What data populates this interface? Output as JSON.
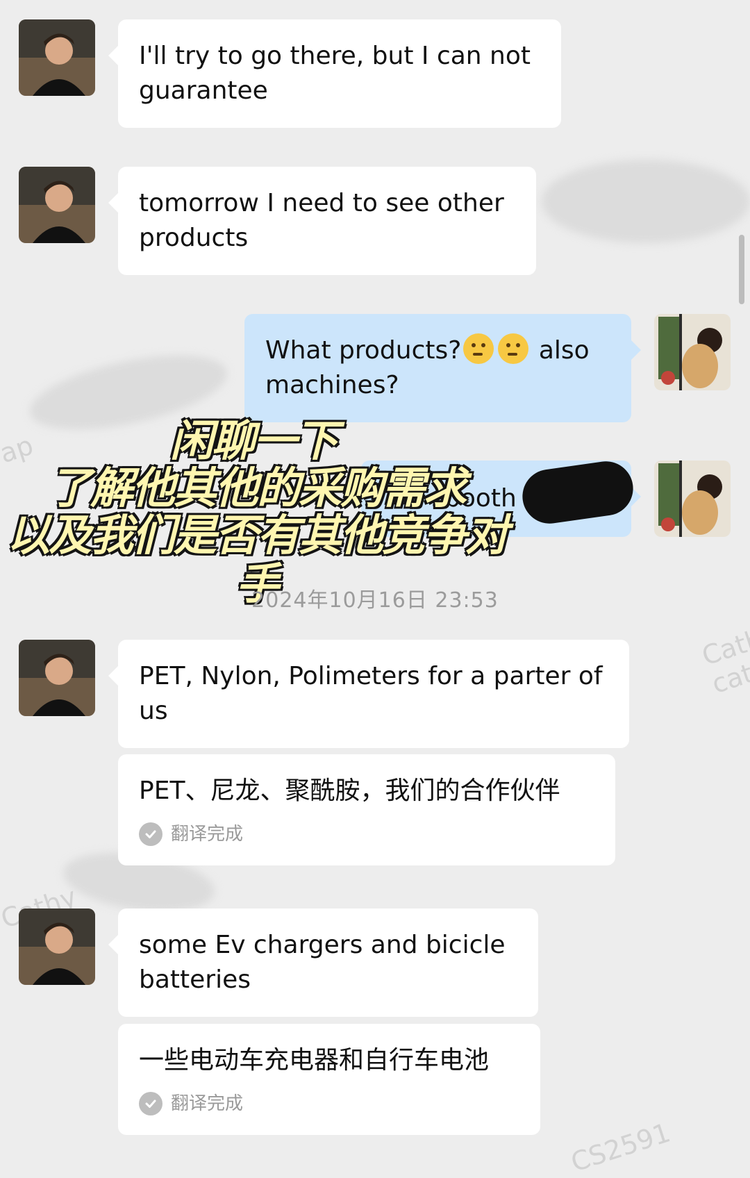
{
  "messages": [
    {
      "text": "I'll try to go there, but I can not guarantee"
    },
    {
      "text": "tomorrow I need to see other products"
    },
    {
      "text_before": "What products?",
      "emoji": "thinking-face",
      "text_after": "also machines?"
    },
    {
      "text": "booth"
    },
    {
      "text": "PET, Nylon, Polimeters for a parter of us",
      "translation": "PET、尼龙、聚酰胺，我们的合作伙伴"
    },
    {
      "text": "some Ev chargers and bicicle batteries",
      "translation": "一些电动车充电器和自行车电池"
    }
  ],
  "translation_status": "翻译完成",
  "timestamp": "2024年10月16日 23:53",
  "overlay_caption": {
    "line1": "闲聊一下",
    "line2": "了解他其他的采购需求",
    "line3": "以及我们是否有其他竞争对手"
  },
  "watermarks": [
    "Cath",
    "cat",
    "Cathy",
    "CS2591",
    "ap"
  ]
}
